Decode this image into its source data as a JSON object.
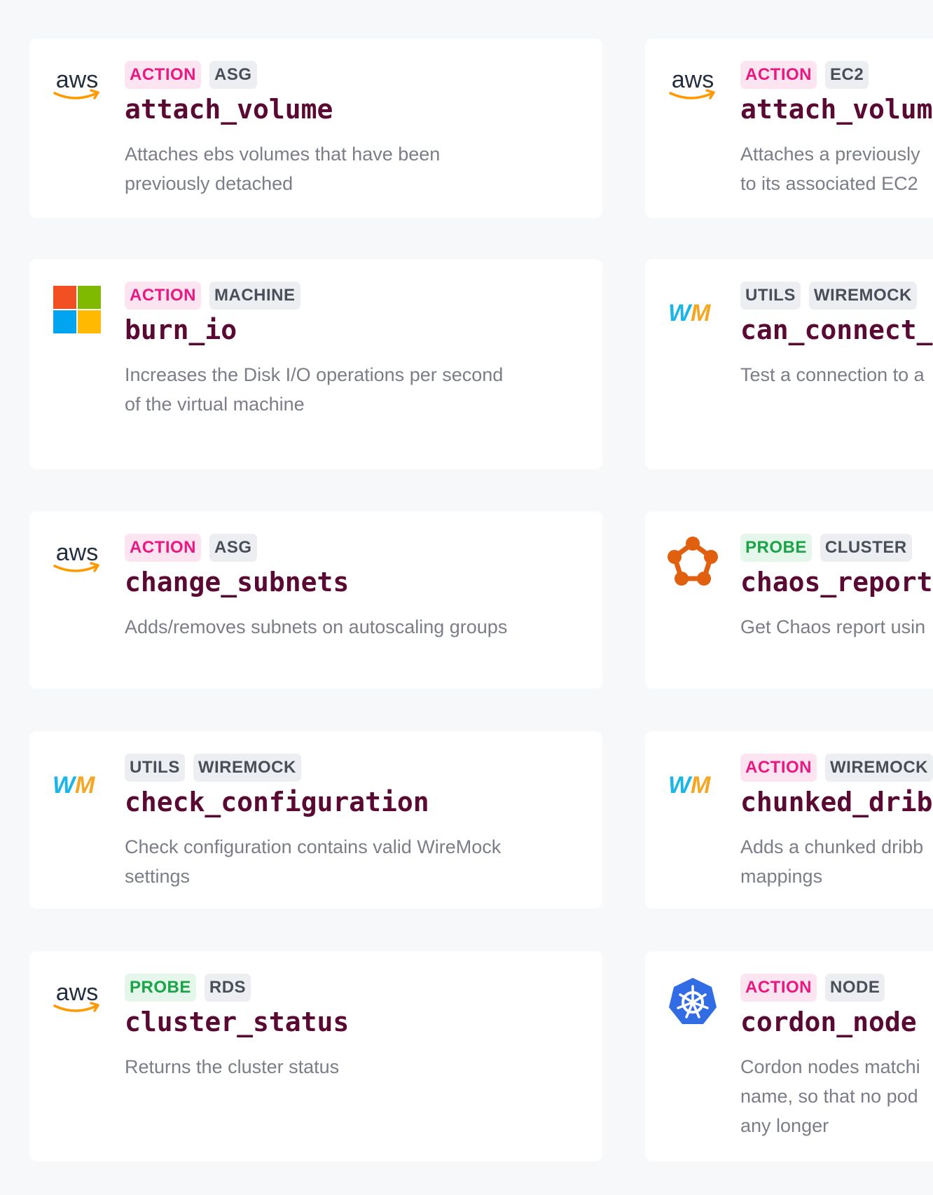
{
  "cards": [
    {
      "logo": "aws-logo-icon",
      "tag_kind": "ACTION",
      "tag_cat": "ASG",
      "title": "attach_volume",
      "desc": "Attaches ebs volumes that have been\npreviously detached"
    },
    {
      "logo": "aws-logo-icon",
      "tag_kind": "ACTION",
      "tag_cat": "EC2",
      "title": "attach_volume",
      "desc": "Attaches a previously\nto its associated EC2"
    },
    {
      "logo": "microsoft-logo-icon",
      "tag_kind": "ACTION",
      "tag_cat": "MACHINE",
      "title": "burn_io",
      "desc": "Increases the Disk I/O operations per second\nof the virtual machine"
    },
    {
      "logo": "wiremock-logo-icon",
      "tag_kind": "UTILS",
      "tag_cat": "WIREMOCK",
      "title": "can_connect_t",
      "desc": "Test a connection to a"
    },
    {
      "logo": "aws-logo-icon",
      "tag_kind": "ACTION",
      "tag_cat": "ASG",
      "title": "change_subnets",
      "desc": "Adds/removes subnets on autoscaling groups"
    },
    {
      "logo": "chaos-pentagon-icon",
      "tag_kind": "PROBE",
      "tag_cat": "CLUSTER",
      "title": "chaos_report",
      "desc": "Get Chaos report usin"
    },
    {
      "logo": "wiremock-logo-icon",
      "tag_kind": "UTILS",
      "tag_cat": "WIREMOCK",
      "title": "check_configuration",
      "desc": "Check configuration contains valid WireMock\nsettings"
    },
    {
      "logo": "wiremock-logo-icon",
      "tag_kind": "ACTION",
      "tag_cat": "WIREMOCK",
      "title": "chunked_dribb",
      "desc": "Adds a chunked dribb\nmappings"
    },
    {
      "logo": "aws-logo-icon",
      "tag_kind": "PROBE",
      "tag_cat": "RDS",
      "title": "cluster_status",
      "desc": "Returns the cluster status"
    },
    {
      "logo": "kubernetes-logo-icon",
      "tag_kind": "ACTION",
      "tag_cat": "NODE",
      "title": "cordon_node",
      "desc": "Cordon nodes matchi\nname, so that no pod\nany longer"
    }
  ]
}
